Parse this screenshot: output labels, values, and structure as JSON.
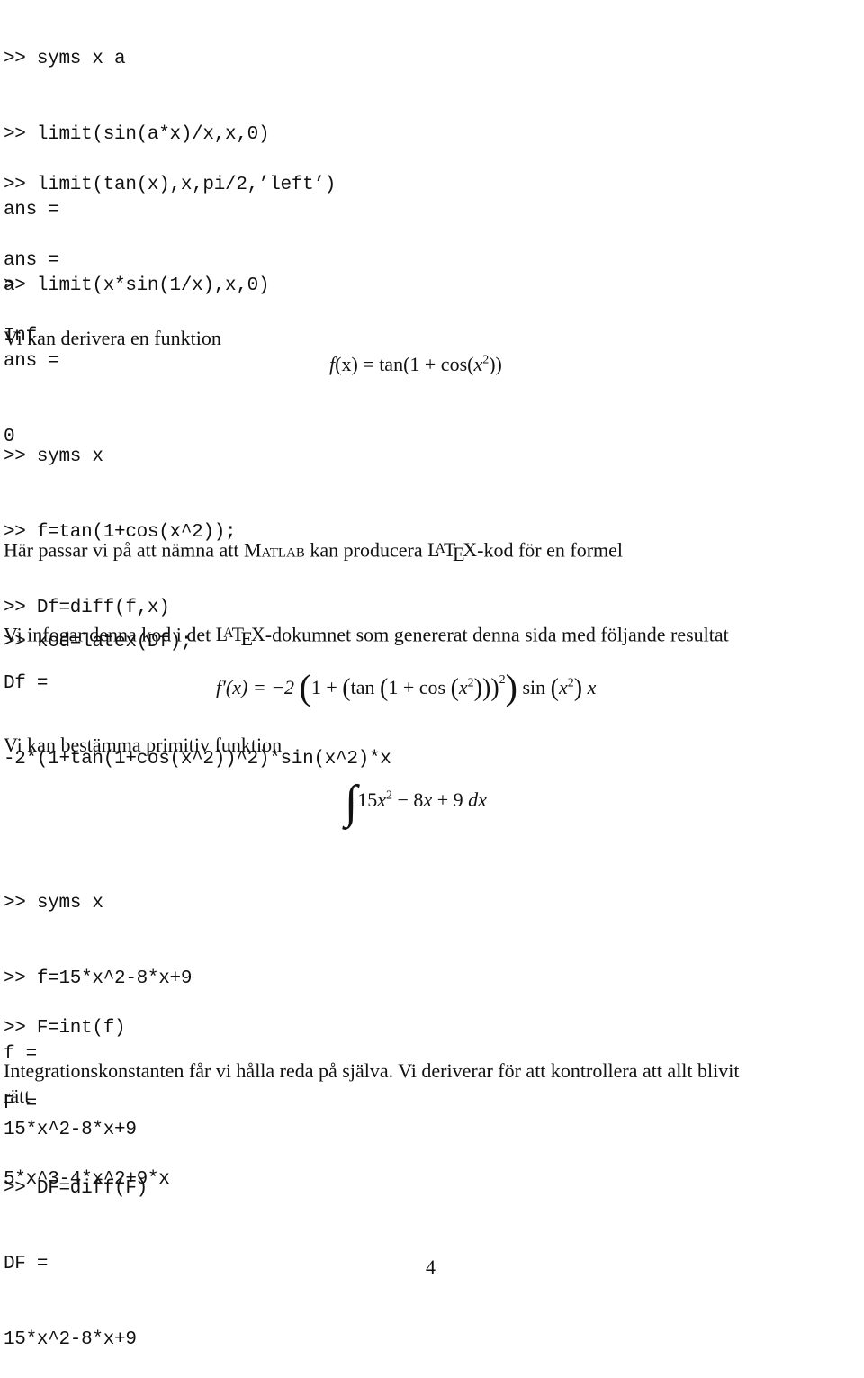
{
  "block1": {
    "lines": [
      ">> syms x a",
      ">> limit(sin(a*x)/x,x,0)",
      "ans =",
      "a"
    ]
  },
  "block2": {
    "lines": [
      ">> limit(tan(x),x,pi/2,’left’)",
      "ans =",
      "Inf"
    ]
  },
  "block3": {
    "lines": [
      ">> limit(x*sin(1/x),x,0)",
      "ans =",
      "0"
    ]
  },
  "para_derive": "Vi kan derivera en funktion",
  "formula_f": {
    "lhs": "f",
    "arg": "(x)",
    "eq": " = tan(1 + cos(",
    "x": "x",
    "exp": "2",
    "close": "))"
  },
  "block4": {
    "lines": [
      ">> syms x",
      ">> f=tan(1+cos(x^2));",
      ">> Df=diff(f,x)",
      "Df =",
      "-2*(1+tan(1+cos(x^2))^2)*sin(x^2)*x"
    ]
  },
  "para_matlab": {
    "before": "Här passar vi på att nämna att ",
    "matlab": "Matlab",
    "middle": " kan producera ",
    "after": "-kod för en formel"
  },
  "latex_logo": {
    "l": "L",
    "a": "A",
    "t": "T",
    "e": "E",
    "x": "X"
  },
  "block5": {
    "lines": [
      ">> kod=latex(Df);"
    ]
  },
  "para_insert": {
    "before": "Vi infogar denna kod i det ",
    "after": "-dokumnet som genererat denna sida med följande resultat"
  },
  "formula_df": {
    "lhs": "f′(x) = −2",
    "part1": "1 + ",
    "part2": "tan ",
    "part3": "1 + cos ",
    "x": "x",
    "exp": "2",
    "outer_exp": "2",
    "sin": "sin ",
    "tail_x": "x"
  },
  "para_primitive": "Vi kan bestämma primitiv funktion",
  "formula_int": {
    "integral": "∫",
    "c1": "15",
    "x": "x",
    "exp": "2",
    "rest": " − 8",
    "x2": "x",
    "plus": " + 9 ",
    "dx": "dx"
  },
  "block6": {
    "lines": [
      ">> syms x",
      ">> f=15*x^2-8*x+9",
      "f =",
      "15*x^2-8*x+9"
    ]
  },
  "block7": {
    "lines": [
      ">> F=int(f)",
      "F =",
      "5*x^3-4*x^2+9*x"
    ]
  },
  "para_integration": {
    "line1": "Integrationskonstanten får vi hålla reda på själva. Vi deriverar för att kontrollera att allt blivit",
    "line2": "rätt"
  },
  "block8": {
    "lines": [
      ">> DF=diff(F)",
      "DF =",
      "15*x^2-8*x+9"
    ]
  },
  "page_number": "4"
}
